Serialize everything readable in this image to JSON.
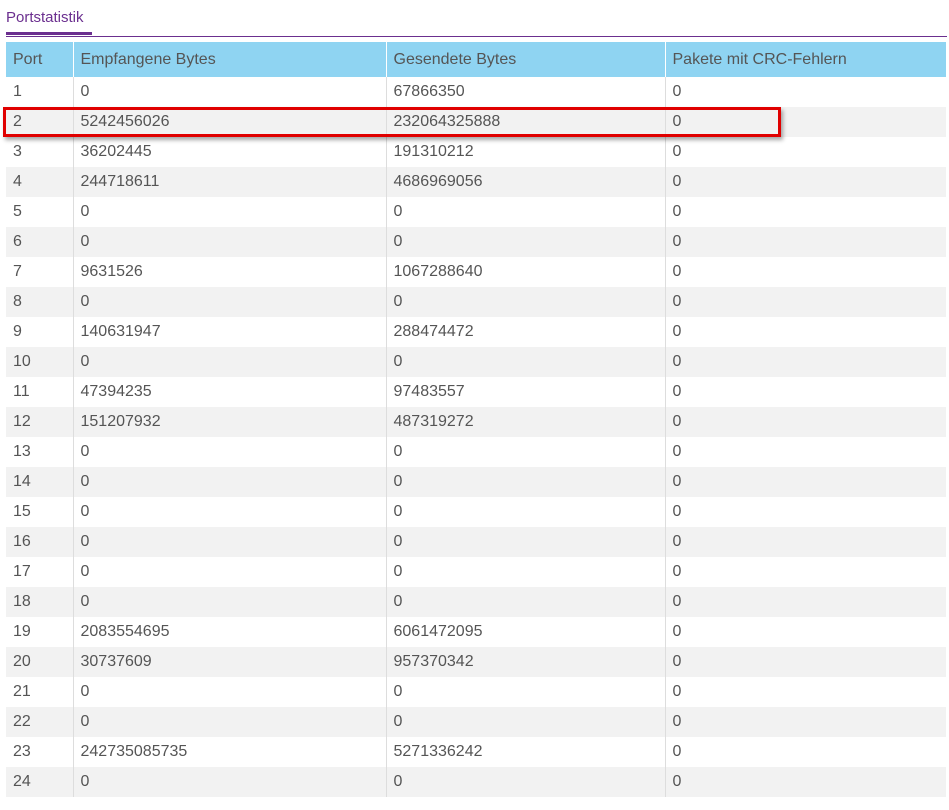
{
  "tab": {
    "title": "Portstatistik"
  },
  "table": {
    "headers": [
      "Port",
      "Empfangene Bytes",
      "Gesendete Bytes",
      "Pakete mit CRC-Fehlern"
    ],
    "rows": [
      [
        "1",
        "0",
        "67866350",
        "0"
      ],
      [
        "2",
        "5242456026",
        "232064325888",
        "0"
      ],
      [
        "3",
        "36202445",
        "191310212",
        "0"
      ],
      [
        "4",
        "244718611",
        "4686969056",
        "0"
      ],
      [
        "5",
        "0",
        "0",
        "0"
      ],
      [
        "6",
        "0",
        "0",
        "0"
      ],
      [
        "7",
        "9631526",
        "1067288640",
        "0"
      ],
      [
        "8",
        "0",
        "0",
        "0"
      ],
      [
        "9",
        "140631947",
        "288474472",
        "0"
      ],
      [
        "10",
        "0",
        "0",
        "0"
      ],
      [
        "11",
        "47394235",
        "97483557",
        "0"
      ],
      [
        "12",
        "151207932",
        "487319272",
        "0"
      ],
      [
        "13",
        "0",
        "0",
        "0"
      ],
      [
        "14",
        "0",
        "0",
        "0"
      ],
      [
        "15",
        "0",
        "0",
        "0"
      ],
      [
        "16",
        "0",
        "0",
        "0"
      ],
      [
        "17",
        "0",
        "0",
        "0"
      ],
      [
        "18",
        "0",
        "0",
        "0"
      ],
      [
        "19",
        "2083554695",
        "6061472095",
        "0"
      ],
      [
        "20",
        "30737609",
        "957370342",
        "0"
      ],
      [
        "21",
        "0",
        "0",
        "0"
      ],
      [
        "22",
        "0",
        "0",
        "0"
      ],
      [
        "23",
        "242735085735",
        "5271336242",
        "0"
      ],
      [
        "24",
        "0",
        "0",
        "0"
      ]
    ],
    "highlighted_port": "2"
  },
  "colors": {
    "accent": "#6b2f8f",
    "header_bg": "#8fd4f2",
    "row_alt_bg": "#f2f2f2",
    "highlight": "#e00000",
    "text": "#555555"
  }
}
